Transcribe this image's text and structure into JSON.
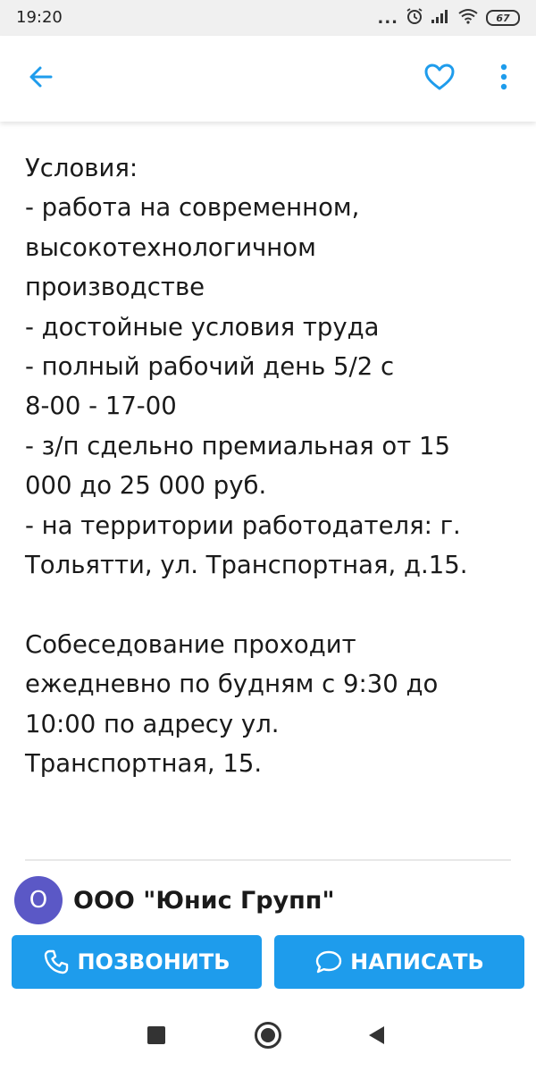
{
  "status_bar": {
    "time": "19:20",
    "dots": "...",
    "battery": "67",
    "icons": [
      "alarm-icon",
      "signal-icon",
      "wifi-icon",
      "battery-icon"
    ]
  },
  "app_bar": {
    "icons": [
      "back-arrow-icon",
      "heart-icon",
      "more-vertical-icon"
    ],
    "accent_color": "#1e9cec"
  },
  "description": {
    "block1": [
      "Условия:",
      "- работа на современном,",
      "высокотехнологичном",
      "производстве",
      "- достойные условия труда",
      "- полный рабочий день 5/2 с",
      "8-00 - 17-00",
      "- з/п сдельно премиальная от 15",
      "000 до 25 000 руб.",
      "- на территории работодателя: г.",
      "Тольятти, ул. Транспортная, д.15."
    ],
    "block2": [
      "Собеседование проходит",
      "ежедневно по будням с 9:30 до",
      "10:00 по адресу ул.",
      "Транспортная, 15."
    ]
  },
  "company": {
    "avatar_letter": "О",
    "avatar_color": "#5b58c6",
    "name": "ООО \"Юнис Групп\""
  },
  "actions": {
    "call_label": "ПОЗВОНИТЬ",
    "write_label": "НАПИСАТЬ",
    "button_color": "#1e9cec"
  },
  "nav_bar": {
    "icons": [
      "recent-apps-icon",
      "home-icon",
      "back-triangle-icon"
    ]
  }
}
